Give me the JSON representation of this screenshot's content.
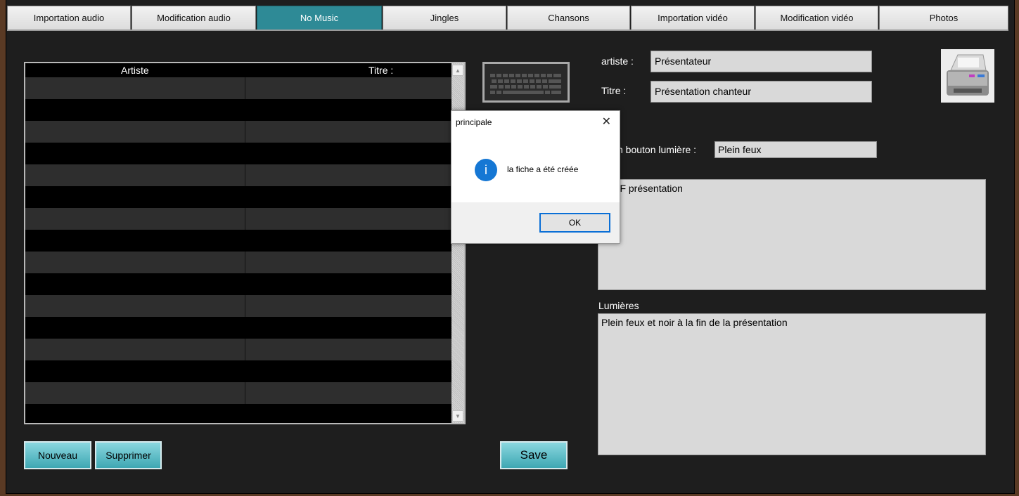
{
  "tabs": [
    {
      "label": "Importation audio",
      "active": false
    },
    {
      "label": "Modification audio",
      "active": false
    },
    {
      "label": "No Music",
      "active": true
    },
    {
      "label": "Jingles",
      "active": false
    },
    {
      "label": "Chansons",
      "active": false
    },
    {
      "label": "Importation vidéo",
      "active": false
    },
    {
      "label": "Modification vidéo",
      "active": false
    },
    {
      "label": "Photos",
      "active": false
    }
  ],
  "table": {
    "columns": [
      "Artiste",
      "Titre :"
    ],
    "rows": 16
  },
  "buttons": {
    "nouveau": "Nouveau",
    "supprimer": "Supprimer",
    "save": "Save"
  },
  "form": {
    "artiste_label": "artiste :",
    "artiste_value": "Présentateur",
    "titre_label": "Titre :",
    "titre_value": "Présentation chanteur",
    "bouton_label": "n bouton lumière :",
    "bouton_value": "Plein feux",
    "notes_text": "ro HF présentation",
    "lumieres_label": "Lumières",
    "lumieres_text": "Plein feux et noir à la fin de la présentation"
  },
  "dialog": {
    "title": "principale",
    "message": "la fiche a été créée",
    "ok_label": "OK",
    "close_glyph": "✕",
    "info_glyph": "i"
  },
  "icons": {
    "keyboard": "keyboard-icon",
    "printer": "printer-icon"
  },
  "colors": {
    "accent": "#2e8a96",
    "background": "#1e1e1e",
    "dialog_button_border": "#0a6fd6"
  }
}
